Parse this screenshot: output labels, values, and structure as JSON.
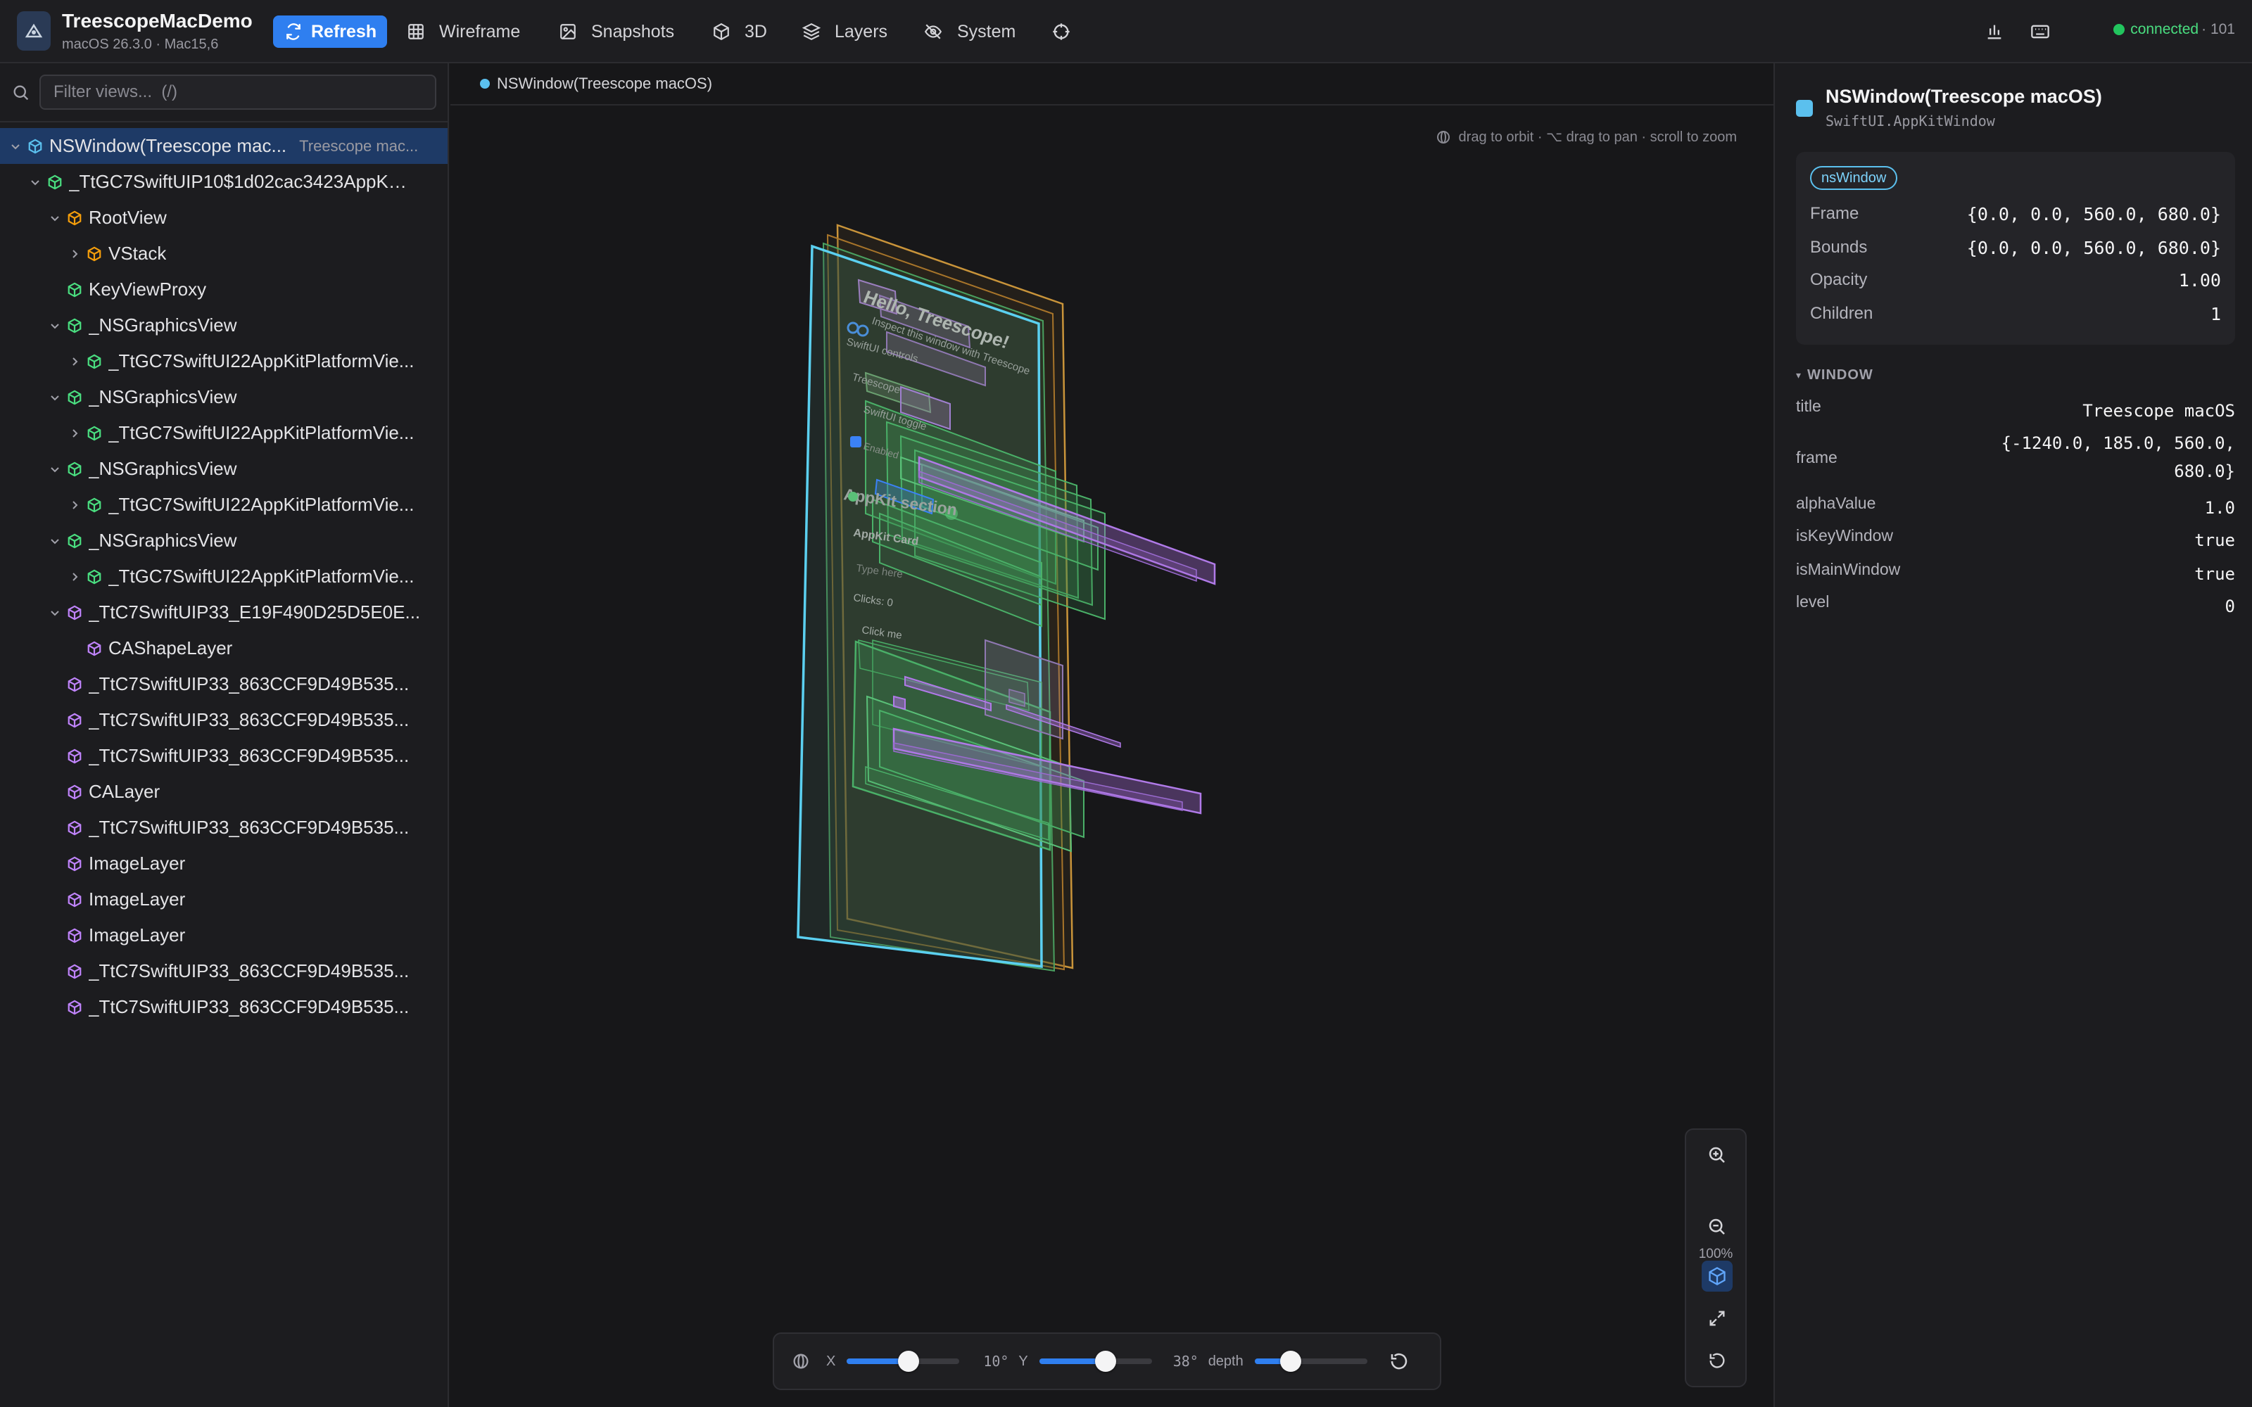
{
  "app": {
    "name": "TreescopeMacDemo",
    "subtitle": "macOS 26.3.0 · Mac15,6"
  },
  "toolbar": {
    "refresh": "Refresh",
    "tabs": [
      {
        "label": "Wireframe",
        "icon": "grid-icon"
      },
      {
        "label": "Snapshots",
        "icon": "image-icon"
      },
      {
        "label": "3D",
        "icon": "cube-icon"
      },
      {
        "label": "Layers",
        "icon": "layers-icon"
      },
      {
        "label": "System",
        "icon": "eye-off-icon"
      }
    ],
    "status": {
      "label": "connected",
      "count": "· 101",
      "color": "#22c55e"
    }
  },
  "search": {
    "placeholder": "Filter views...  (/)",
    "value": ""
  },
  "tree": [
    {
      "label": "NSWindow(Treescope mac...",
      "secondary": "Treescope mac...",
      "indent": 0,
      "chevron": "down",
      "color": "#5bc0ee",
      "selected": true
    },
    {
      "label": "_TtGC7SwiftUIP10$1d02cac3423AppKit...",
      "indent": 1,
      "chevron": "down",
      "color": "#4ade80"
    },
    {
      "label": "RootView",
      "indent": 2,
      "chevron": "down",
      "color": "#f59e0b"
    },
    {
      "label": "VStack",
      "indent": 3,
      "chevron": "right",
      "color": "#f59e0b"
    },
    {
      "label": "KeyViewProxy",
      "indent": 2,
      "chevron": "",
      "color": "#4ade80"
    },
    {
      "label": "_NSGraphicsView",
      "indent": 2,
      "chevron": "down",
      "color": "#4ade80"
    },
    {
      "label": "_TtGC7SwiftUI22AppKitPlatformVie...",
      "indent": 3,
      "chevron": "right",
      "color": "#4ade80"
    },
    {
      "label": "_NSGraphicsView",
      "indent": 2,
      "chevron": "down",
      "color": "#4ade80"
    },
    {
      "label": "_TtGC7SwiftUI22AppKitPlatformVie...",
      "indent": 3,
      "chevron": "right",
      "color": "#4ade80"
    },
    {
      "label": "_NSGraphicsView",
      "indent": 2,
      "chevron": "down",
      "color": "#4ade80"
    },
    {
      "label": "_TtGC7SwiftUI22AppKitPlatformVie...",
      "indent": 3,
      "chevron": "right",
      "color": "#4ade80"
    },
    {
      "label": "_NSGraphicsView",
      "indent": 2,
      "chevron": "down",
      "color": "#4ade80"
    },
    {
      "label": "_TtGC7SwiftUI22AppKitPlatformVie...",
      "indent": 3,
      "chevron": "right",
      "color": "#4ade80"
    },
    {
      "label": "_TtC7SwiftUIP33_E19F490D25D5E0E...",
      "indent": 2,
      "chevron": "down",
      "color": "#c084fc"
    },
    {
      "label": "CAShapeLayer",
      "indent": 3,
      "chevron": "",
      "color": "#c084fc"
    },
    {
      "label": "_TtC7SwiftUIP33_863CCF9D49B535...",
      "indent": 2,
      "chevron": "",
      "color": "#c084fc"
    },
    {
      "label": "_TtC7SwiftUIP33_863CCF9D49B535...",
      "indent": 2,
      "chevron": "",
      "color": "#c084fc"
    },
    {
      "label": "_TtC7SwiftUIP33_863CCF9D49B535...",
      "indent": 2,
      "chevron": "",
      "color": "#c084fc"
    },
    {
      "label": "CALayer",
      "indent": 2,
      "chevron": "",
      "color": "#c084fc"
    },
    {
      "label": "_TtC7SwiftUIP33_863CCF9D49B535...",
      "indent": 2,
      "chevron": "",
      "color": "#c084fc"
    },
    {
      "label": "ImageLayer",
      "indent": 2,
      "chevron": "",
      "color": "#c084fc"
    },
    {
      "label": "ImageLayer",
      "indent": 2,
      "chevron": "",
      "color": "#c084fc"
    },
    {
      "label": "ImageLayer",
      "indent": 2,
      "chevron": "",
      "color": "#c084fc"
    },
    {
      "label": "_TtC7SwiftUIP33_863CCF9D49B535...",
      "indent": 2,
      "chevron": "",
      "color": "#c084fc"
    },
    {
      "label": "_TtC7SwiftUIP33_863CCF9D49B535...",
      "indent": 2,
      "chevron": "",
      "color": "#c084fc"
    }
  ],
  "viewport": {
    "breadcrumb": "NSWindow(Treescope macOS)",
    "hint": "drag to orbit · ⌥ drag to pan · scroll to zoom",
    "scene_text": {
      "hello": "Hello, Treescope!",
      "inspect": "Inspect this window with Treescope",
      "swiftui_controls": "SwiftUI controls",
      "treescope": "Treescope",
      "toggle": "SwiftUI toggle",
      "enabled": "Enabled",
      "appkit_section": "AppKit section",
      "appkit_card": "AppKit Card",
      "type_here": "Type here",
      "clicks": "Clicks: 0",
      "click_me": "Click me"
    },
    "zoom": "100%",
    "orbit": {
      "x_label": "X",
      "x_value": "10°",
      "x_level": 0.55,
      "y_label": "Y",
      "y_value": "38°",
      "y_level": 0.59,
      "depth_label": "depth",
      "depth_level": 0.32
    }
  },
  "inspector": {
    "title": "NSWindow(Treescope macOS)",
    "subtitle": "SwiftUI.AppKitWindow",
    "badge": "nsWindow",
    "props": [
      {
        "key": "Frame",
        "value": "{0.0, 0.0, 560.0, 680.0}"
      },
      {
        "key": "Bounds",
        "value": "{0.0, 0.0, 560.0, 680.0}"
      },
      {
        "key": "Opacity",
        "value": "1.00"
      },
      {
        "key": "Children",
        "value": "1"
      }
    ],
    "section": "WINDOW",
    "window_props": [
      {
        "key": "title",
        "value": "Treescope macOS"
      },
      {
        "key": "frame",
        "value": "{-1240.0, 185.0, 560.0, 680.0}"
      },
      {
        "key": "alphaValue",
        "value": "1.0"
      },
      {
        "key": "isKeyWindow",
        "value": "true"
      },
      {
        "key": "isMainWindow",
        "value": "true"
      },
      {
        "key": "level",
        "value": "0"
      }
    ]
  }
}
